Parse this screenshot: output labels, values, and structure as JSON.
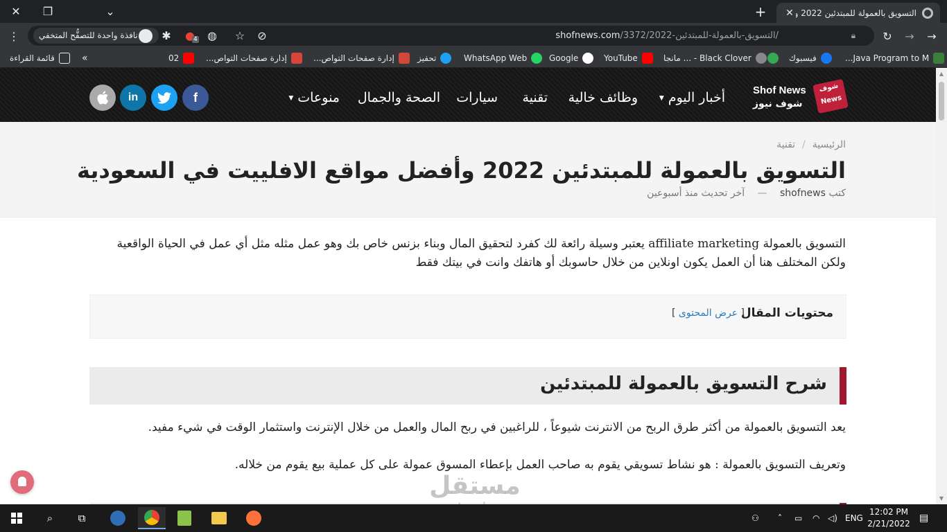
{
  "browser": {
    "tab_title": "التسويق بالعمولة للمبتدئين 2022 و",
    "url_domain": "shofnews.com",
    "url_path": "/3372/التسويق-بالعمولة-للمبتدئين-2022/",
    "incognito_label": "نافذة واحدة للتصفُّح المتخفي",
    "extension_badge": "4",
    "bookmarks": [
      {
        "label": "Java Program to M...",
        "icon": "bookmark-icon",
        "color": "#3b7d3a"
      },
      {
        "label": "فيسبوك",
        "icon": "facebook-icon",
        "color": "#1877f2"
      },
      {
        "label": "",
        "icon": "green-icon",
        "color": "#34a853"
      },
      {
        "label": "",
        "icon": "gray-icon",
        "color": "#888888"
      },
      {
        "label": "Black Clover - ... مانجا",
        "icon": "youtube-icon",
        "color": "#ff0000"
      },
      {
        "label": "YouTube",
        "icon": "youtube-icon",
        "color": "#ff0000"
      },
      {
        "label": "Google",
        "icon": "google-icon",
        "color": "#ffffff"
      },
      {
        "label": "WhatsApp Web",
        "icon": "whatsapp-icon",
        "color": "#25d366"
      },
      {
        "label": "تحفيز",
        "icon": "twitter-icon",
        "color": "#1da1f2"
      },
      {
        "label": "إدارة صفحات التواص...",
        "icon": "m-icon",
        "color": "#d44638"
      },
      {
        "label": "إدارة صفحات التواص...",
        "icon": "m-icon",
        "color": "#d44638"
      },
      {
        "label": "02",
        "icon": "youtube-icon",
        "color": "#ff0000"
      }
    ],
    "reading_list": "قائمة القراءة",
    "more_bookmarks": "»"
  },
  "site": {
    "logo_en": "Shof News",
    "logo_ar": "شوف نيوز",
    "logo_badge_top": "شوف",
    "logo_badge_bottom": "News",
    "nav": [
      {
        "label": "أخبار اليوم",
        "has_dropdown": true
      },
      {
        "label": "وظائف خالية",
        "has_dropdown": false
      },
      {
        "label": "تقنية",
        "has_dropdown": false
      },
      {
        "label": "سيارات",
        "has_dropdown": false
      },
      {
        "label": "الصحة والجمال",
        "has_dropdown": false
      },
      {
        "label": "منوعات",
        "has_dropdown": true
      }
    ],
    "social": [
      {
        "name": "facebook",
        "glyph": "f",
        "color": "#3b5998"
      },
      {
        "name": "twitter",
        "glyph": "t",
        "color": "#1da1f2"
      },
      {
        "name": "linkedin",
        "glyph": "in",
        "color": "#0e76a8"
      },
      {
        "name": "apple",
        "glyph": "",
        "color": "#aaaaaa"
      }
    ]
  },
  "article": {
    "breadcrumb": [
      "الرئيسية",
      "تقنية"
    ],
    "breadcrumb_sep": "/",
    "title": "التسويق بالعمولة للمبتدئين 2022 وأفضل مواقع الافلييت في السعودية",
    "meta_author_prefix": "كتب",
    "meta_author": "shofnews",
    "meta_sep": "—",
    "meta_updated": "آخر تحديث منذ أسبوعين",
    "intro": "التسويق بالعمولة affiliate marketing يعتبر وسيلة رائعة لك كفرد لتحقيق المال وبناء بزنس خاص بك وهو عمل مثله مثل أي عمل في الحياة الواقعية ولكن المختلف هنا أن العمل يكون اونلاين من خلال حاسوبك أو هاتفك وانت في بيتك فقط",
    "toc_title": "محتويات المقال",
    "toc_toggle": "عرض المحتوى",
    "toc_bracket_open": "[",
    "toc_bracket_close": "]",
    "h2": "شرح التسويق بالعمولة للمبتدئين",
    "para1": " يعد التسويق بالعمولة من أكثر طرق الربح من الانترنت شيوعاً ، للراغبين في ربح المال والعمل من خلال الإنترنت واستثمار الوقت في شيء مفيد.",
    "para2": "وتعريف التسويق بالعمولة : هو نشاط تسويقي يقوم به صاحب العمل بإعطاء المسوق عمولة على كل عملية بيع يقوم من خلاله."
  },
  "watermark": {
    "ar": "مستقل",
    "en": "mostaql.com"
  },
  "taskbar": {
    "language": "ENG",
    "time": "12:02 PM",
    "date": "2/21/2022",
    "notification_count": "1"
  },
  "colors": {
    "accent": "#a01730",
    "header_bg": "#191919",
    "link": "#2b7bb9"
  }
}
